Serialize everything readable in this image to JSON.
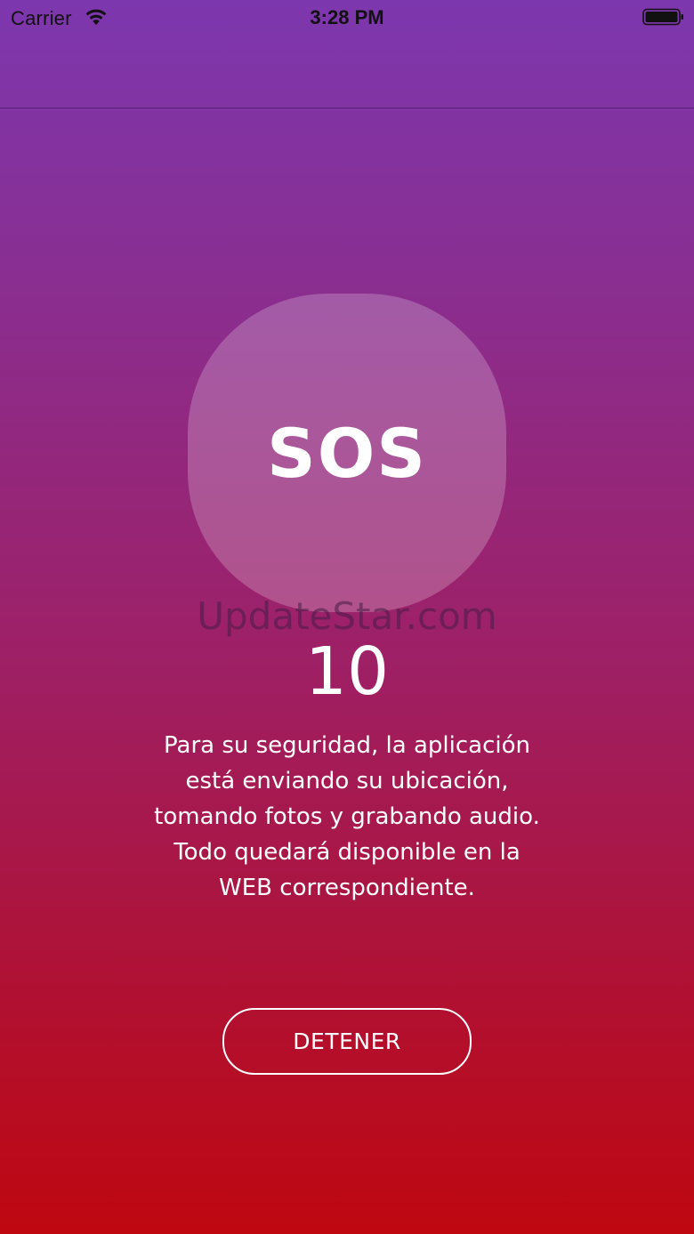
{
  "status_bar": {
    "carrier": "Carrier",
    "time": "3:28 PM",
    "wifi_icon": "wifi-icon",
    "battery_icon": "battery-icon"
  },
  "sos": {
    "label": "SOS"
  },
  "watermark": "UpdateStar.com",
  "countdown": "10",
  "message": "Para su seguridad, la aplicación está enviando su ubicación, tomando fotos y grabando audio. Todo quedará disponible en la WEB correspondiente.",
  "stop_button": {
    "label": "DETENER"
  },
  "colors": {
    "gradient_top": "#7d37ae",
    "gradient_bottom": "#bf0710",
    "text": "#ffffff"
  }
}
